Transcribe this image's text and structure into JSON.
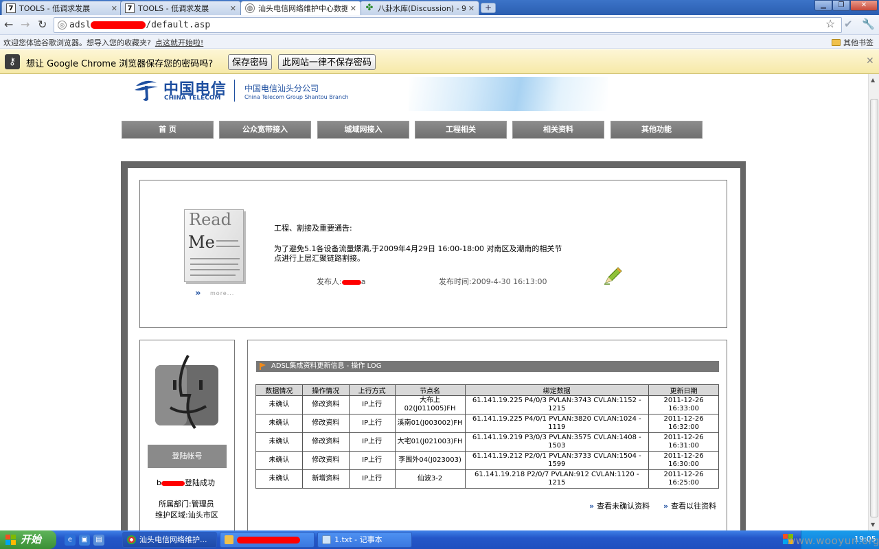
{
  "browser": {
    "tabs": [
      {
        "title": "TOOLS - 低调求发展",
        "favicon": "7"
      },
      {
        "title": "TOOLS - 低调求发展",
        "favicon": "7"
      },
      {
        "title": "汕头电信网络维护中心数据",
        "favicon": "globe"
      },
      {
        "title": "八卦水库(Discussion) - 9",
        "favicon": "leaf"
      }
    ],
    "new_tab_label": "+",
    "window_buttons": [
      "minimize",
      "maximize",
      "close"
    ],
    "url_prefix": "adsl",
    "url_suffix": "/default.asp",
    "bookmark_bar_text": "欢迎您体验谷歌浏览器。想导入您的收藏夹?",
    "bookmark_bar_link": "点这就开始啦!",
    "other_bookmarks": "其他书签"
  },
  "infobar": {
    "message": "想让 Google Chrome 浏览器保存您的密码吗?",
    "save_button": "保存密码",
    "never_button": "此网站一律不保存密码"
  },
  "site": {
    "logo_cn": "中国电信",
    "logo_en": "CHINA TELECOM",
    "branch_cn": "中国电信汕头分公司",
    "branch_en": "China Telecom Group Shantou Branch",
    "nav": [
      "首  页",
      "公众宽带接入",
      "城域网接入",
      "工程相关",
      "相关资料",
      "其他功能"
    ]
  },
  "notice": {
    "readme_line1": "Read",
    "readme_line2": "Me",
    "more_label": "more...",
    "heading": "工程、割接及重要通告:",
    "body": "为了避免5.1各设备流量爆满,于2009年4月29日 16:00-18:00 对南区及潮南的相关节点进行上层汇聚链路割接。",
    "publisher_label": "发布人:",
    "publisher_tail": "a",
    "time_label": "发布时间:2009-4-30 16:13:00"
  },
  "user": {
    "login_button": "登陆帐号",
    "login_status_prefix": "b",
    "login_status_suffix": "登陆成功",
    "department": "所属部门:管理员",
    "region": "维护区域:汕头市区"
  },
  "log": {
    "title": "ADSL集成资料更新信息 - 操作 LOG",
    "headers": [
      "数据情况",
      "操作情况",
      "上行方式",
      "节点名",
      "绑定数据",
      "更新日期"
    ],
    "rows": [
      [
        "未确认",
        "修改资料",
        "IP上行",
        "大布上02(J011005)FH",
        "61.141.19.225  P4/0/3  PVLAN:3743 CVLAN:1152 - 1215",
        "2011-12-26 16:33:00"
      ],
      [
        "未确认",
        "修改资料",
        "IP上行",
        "溪南01(J003002)FH",
        "61.141.19.225  P4/0/1  PVLAN:3820 CVLAN:1024 - 1119",
        "2011-12-26 16:32:00"
      ],
      [
        "未确认",
        "修改资料",
        "IP上行",
        "大宅01(J021003)FH",
        "61.141.19.219  P3/0/3  PVLAN:3575 CVLAN:1408 - 1503",
        "2011-12-26 16:31:00"
      ],
      [
        "未确认",
        "修改资料",
        "IP上行",
        "李围外04(J023003)",
        "61.141.19.212  P2/0/1  PVLAN:3733 CVLAN:1504 - 1599",
        "2011-12-26 16:30:00"
      ],
      [
        "未确认",
        "新增资料",
        "IP上行",
        "仙波3-2",
        "61.141.19.218  P2/0/7  PVLAN:912 CVLAN:1120 - 1215",
        "2011-12-26 16:25:00"
      ]
    ],
    "link_unconfirmed": "查看未确认资料",
    "link_history": "查看以往资料"
  },
  "taskbar": {
    "start_label": "开始",
    "tasks": [
      "汕头电信网络维护...",
      "",
      "1.txt - 记事本"
    ],
    "clock": "19:05",
    "watermark": "www.wooyun.org"
  },
  "colors": {
    "brand_blue": "#1e4fa0",
    "redaction": "#ff0000",
    "nav_gray": "#808080"
  }
}
